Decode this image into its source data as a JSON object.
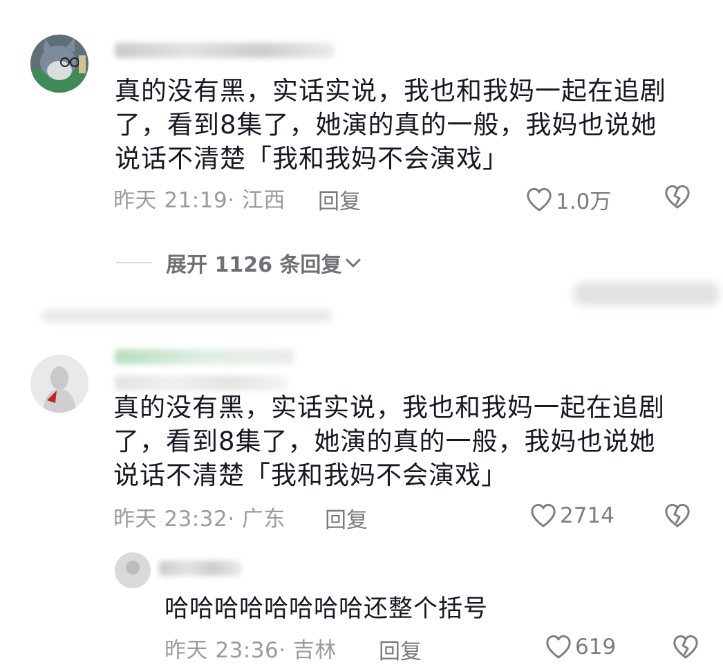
{
  "comments": [
    {
      "text": "真的没有黑，实话实说，我也和我妈一起在追剧了，看到8集了，她演的真的一般，我妈也说她说话不清楚「我和我妈不会演戏」",
      "time_location": "昨天 21:19· 江西",
      "reply_label": "回复",
      "likes": "1.0万",
      "avatar_icon": "cartoon-cat-avatar-icon"
    },
    {
      "text": "真的没有黑，实话实说，我也和我妈一起在追剧了，看到8集了，她演的真的一般，我妈也说她说话不清楚「我和我妈不会演戏」",
      "time_location": "昨天 23:32· 广东",
      "reply_label": "回复",
      "likes": "2714",
      "avatar_icon": "statue-avatar-icon"
    }
  ],
  "expand_replies": {
    "label": "展开 1126 条回复"
  },
  "sub_reply": {
    "text": "哈哈哈哈哈哈哈哈还整个括号",
    "time_location": "昨天 23:36· 吉林",
    "reply_label": "回复",
    "likes": "619"
  },
  "colors": {
    "text": "#161823",
    "meta": "#9a9a9f",
    "icon": "#7d7d82",
    "background": "#ffffff"
  }
}
